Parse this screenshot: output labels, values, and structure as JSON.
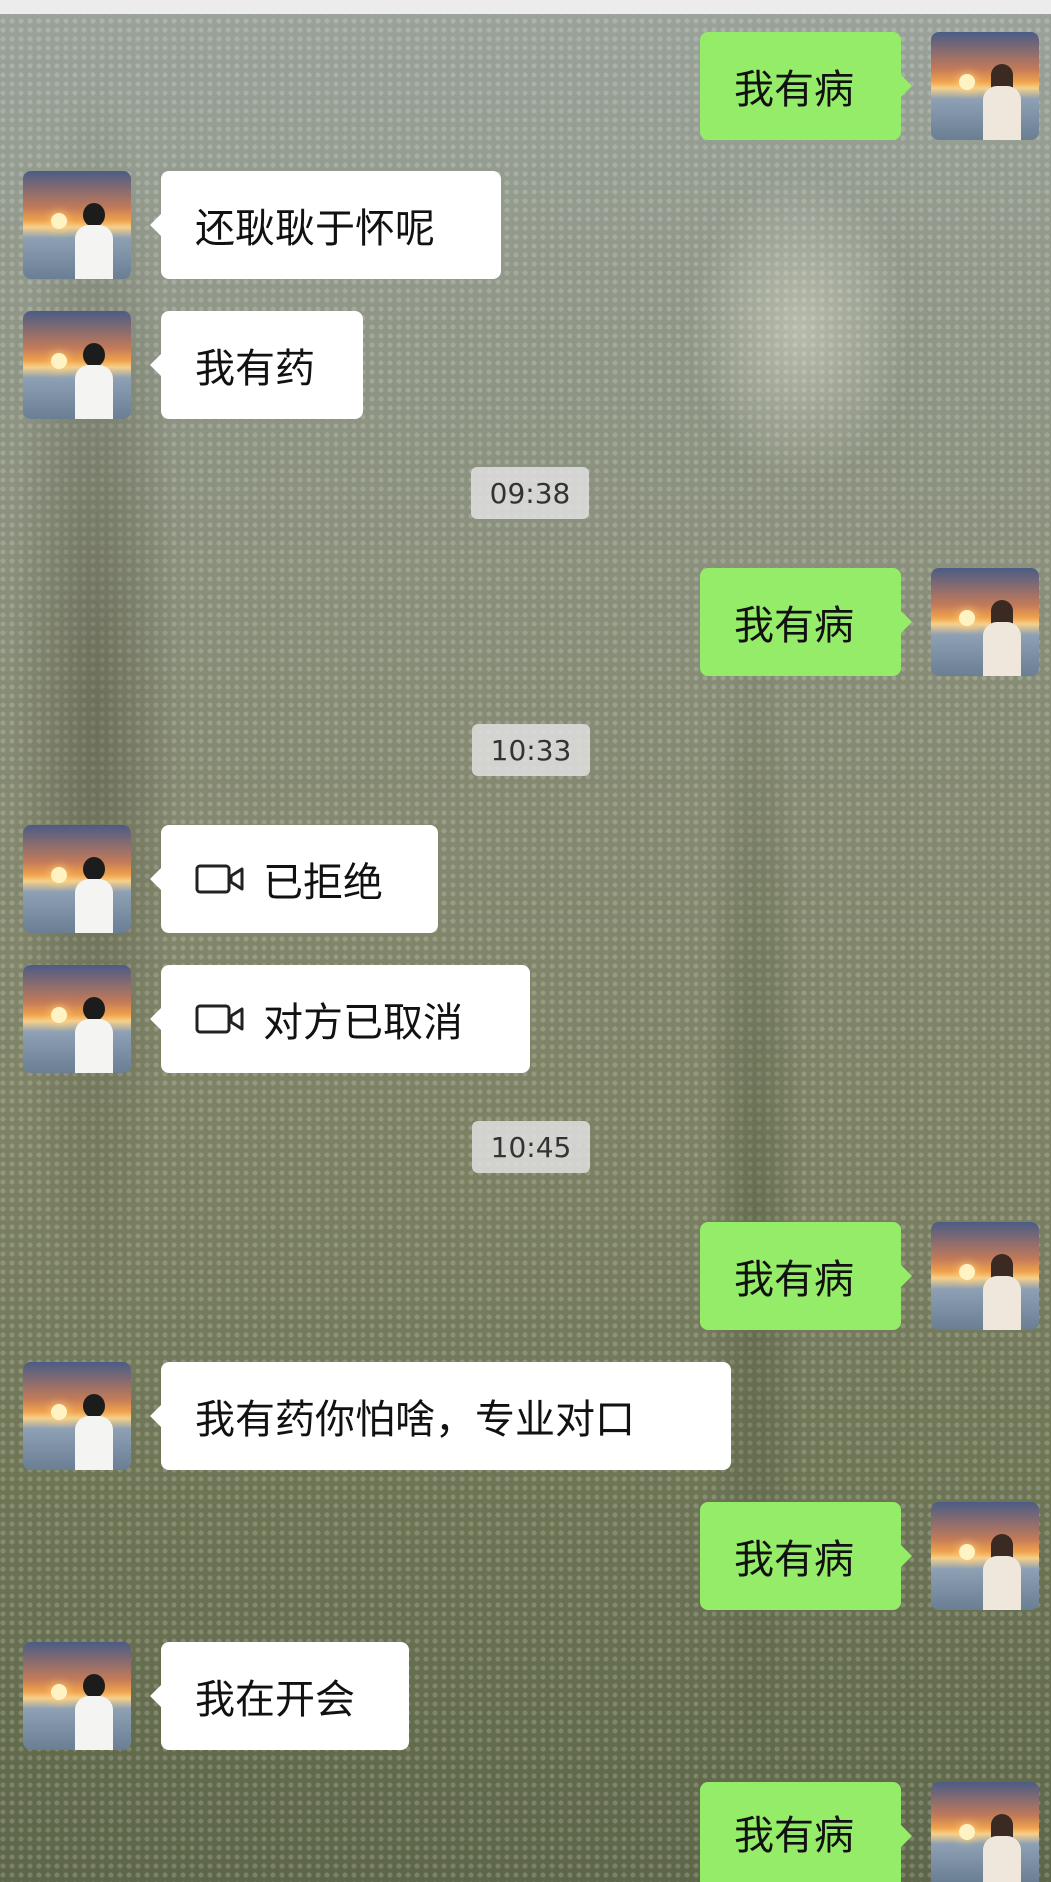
{
  "chat": {
    "messages": [
      {
        "side": "right",
        "text": "我有病"
      },
      {
        "side": "left",
        "text": "还耿耿于怀呢"
      },
      {
        "side": "left",
        "text": "我有药"
      },
      {
        "type": "time",
        "text": "09:38"
      },
      {
        "side": "right",
        "text": "我有病"
      },
      {
        "type": "time",
        "text": "10:33"
      },
      {
        "side": "left",
        "icon": "video-call-icon",
        "text": "已拒绝"
      },
      {
        "side": "left",
        "icon": "video-call-icon",
        "text": "对方已取消"
      },
      {
        "type": "time",
        "text": "10:45"
      },
      {
        "side": "right",
        "text": "我有病"
      },
      {
        "side": "left",
        "text": "我有药你怕啥，专业对口"
      },
      {
        "side": "right",
        "text": "我有病"
      },
      {
        "side": "left",
        "text": "我在开会"
      },
      {
        "side": "right",
        "text": "我有病"
      }
    ]
  },
  "colors": {
    "incoming_bubble": "#ffffff",
    "outgoing_bubble": "#95ec69",
    "timestamp_bg": "#e1e1e1"
  }
}
